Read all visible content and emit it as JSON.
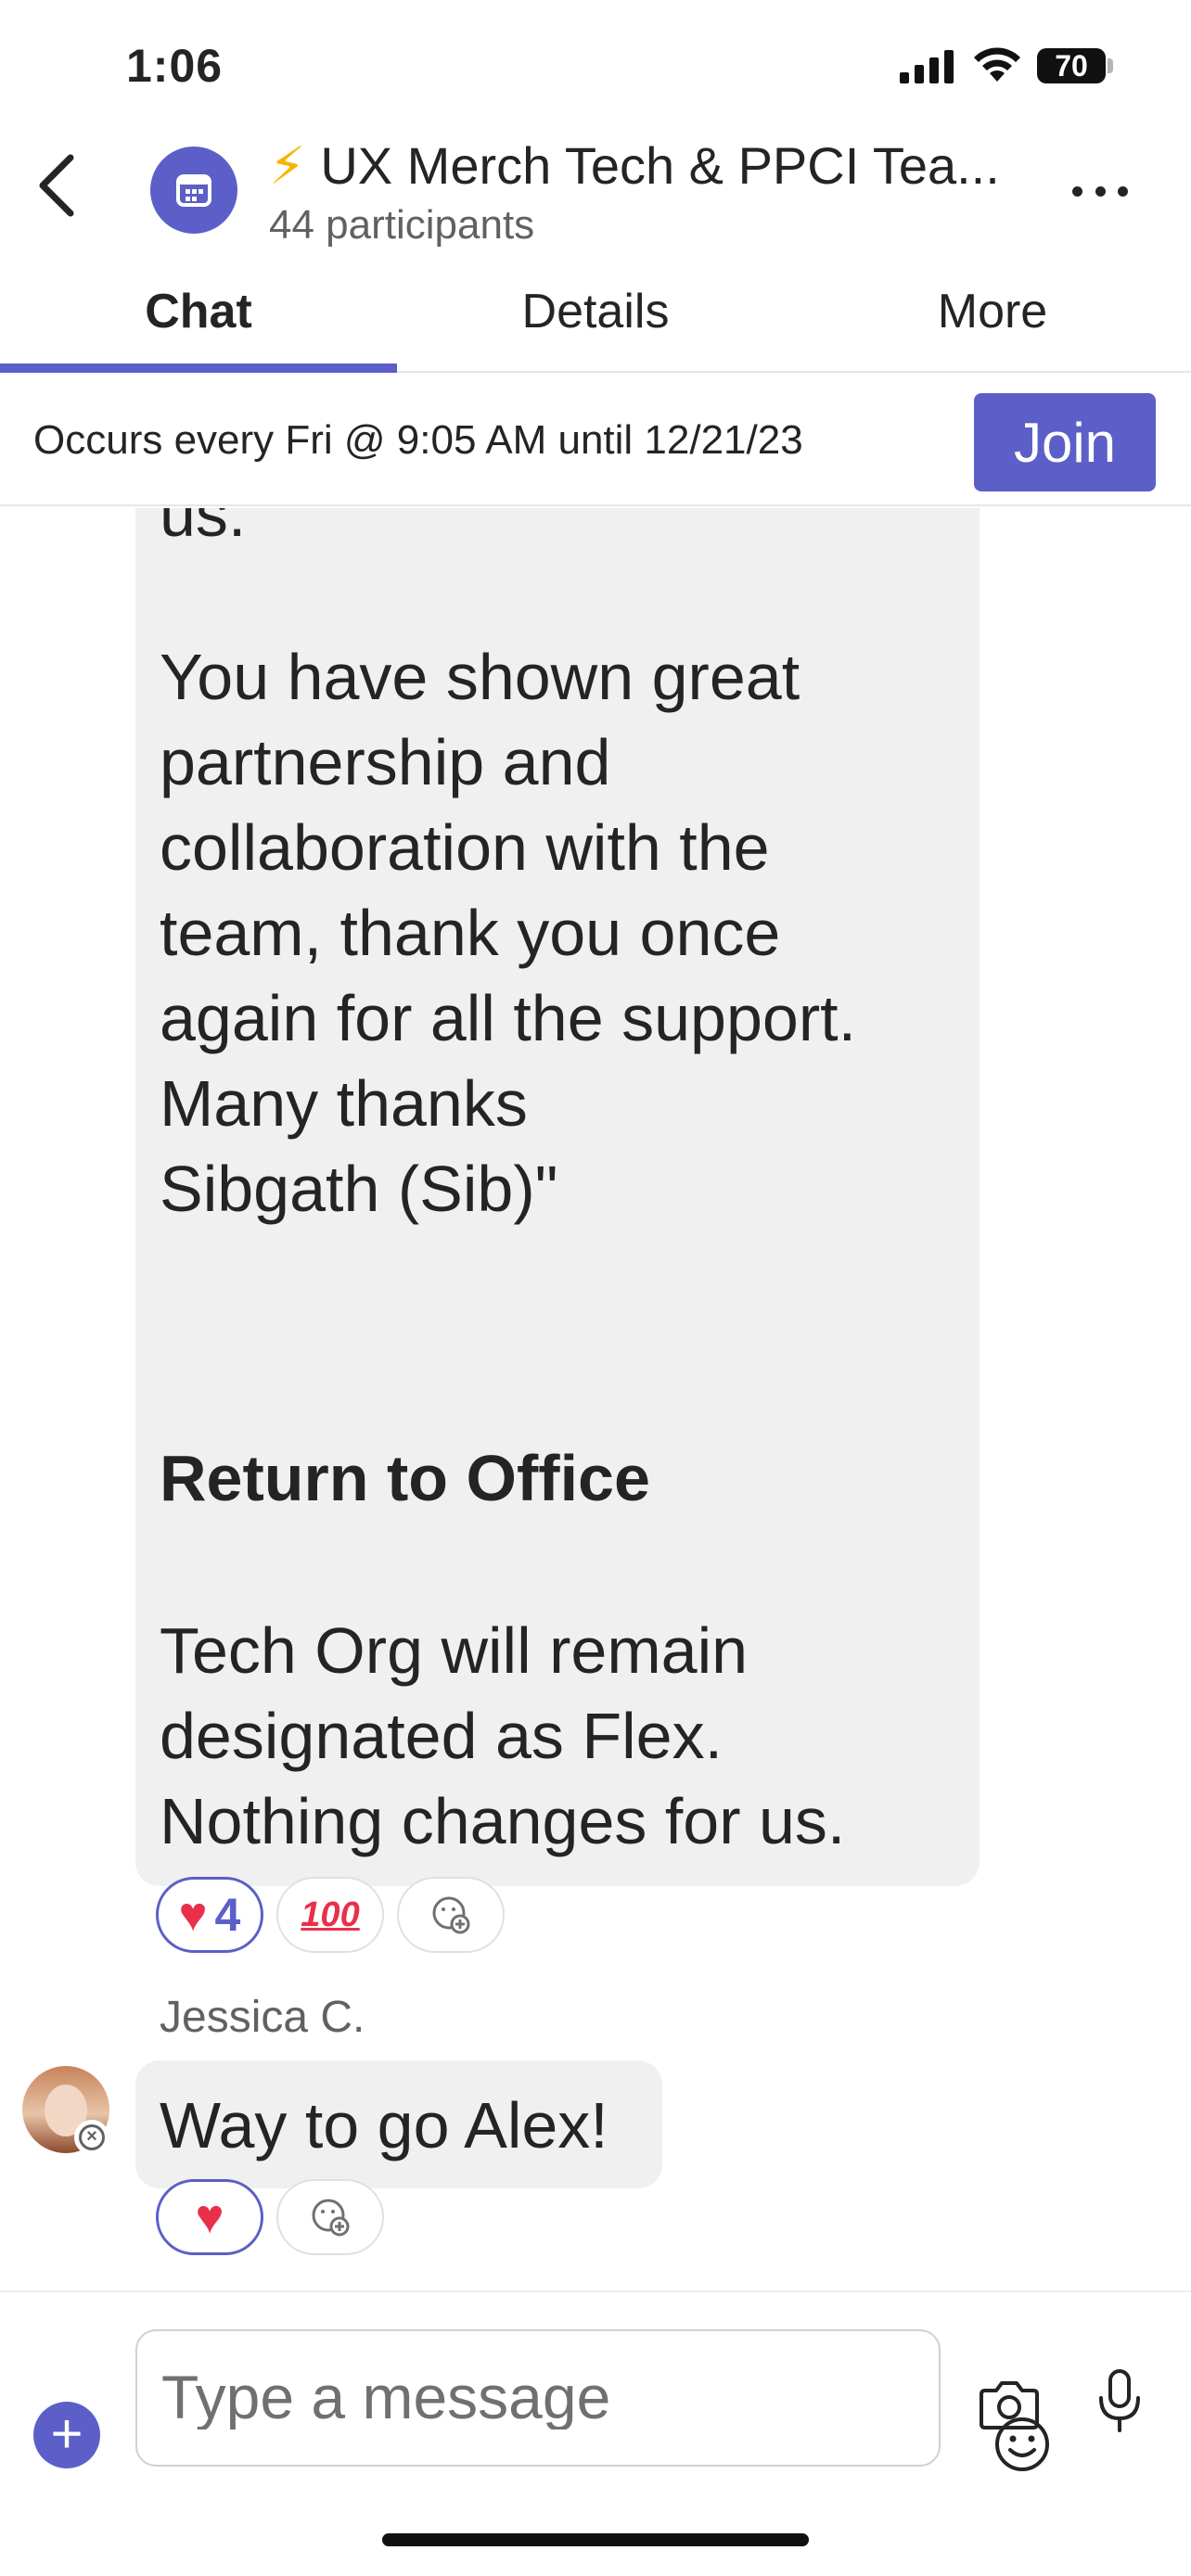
{
  "status_bar": {
    "time": "1:06",
    "battery": "70"
  },
  "header": {
    "title_emoji": "⚡",
    "title": "UX Merch Tech & PPCI Tea...",
    "subtitle": "44 participants"
  },
  "tabs": [
    {
      "label": "Chat",
      "active": true
    },
    {
      "label": "Details",
      "active": false
    },
    {
      "label": "More",
      "active": false
    }
  ],
  "banner": {
    "text": "Occurs every Fri @ 9:05 AM until 12/21/23",
    "join_label": "Join"
  },
  "messages": [
    {
      "lines": [
        "us.",
        "",
        "You have shown great",
        "partnership and",
        "collaboration with the",
        "team, thank you once",
        "again for all the support.",
        "Many thanks",
        "Sibgath (Sib)\"",
        "",
        "",
        "Return to Office",
        "",
        "Tech Org will remain",
        "designated as Flex.",
        "Nothing changes for us."
      ],
      "reactions": {
        "heart_count": "4",
        "hundred": "100"
      }
    },
    {
      "sender": "Jessica C.",
      "text": "Way to go Alex!"
    }
  ],
  "compose": {
    "placeholder": "Type a message"
  },
  "colors": {
    "accent": "#5b5fc7",
    "bubble": "#f0f0f0",
    "heart": "#e8304a"
  }
}
